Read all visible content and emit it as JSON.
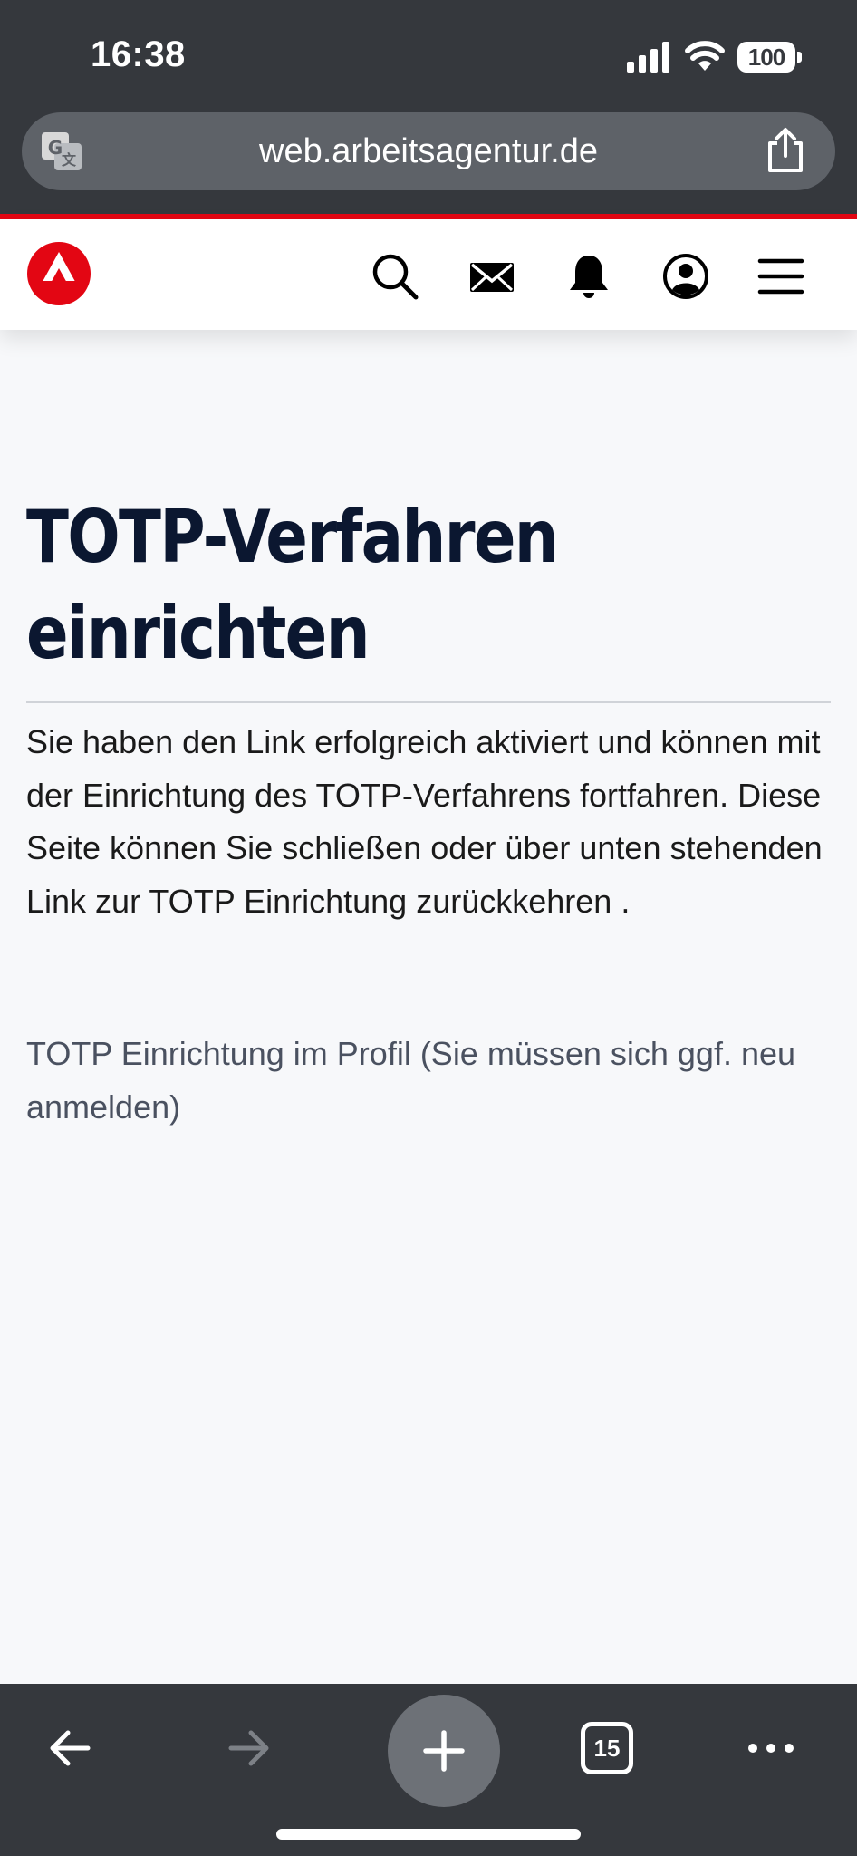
{
  "status_bar": {
    "time": "16:38",
    "battery": "100"
  },
  "browser": {
    "url": "web.arbeitsagentur.de",
    "tab_count": "15"
  },
  "header": {
    "icons": [
      "search-icon",
      "mail-icon",
      "bell-icon",
      "account-icon",
      "menu-icon"
    ]
  },
  "page": {
    "title": "TOTP-Verfahren einrichten",
    "intro": "Sie haben den Link erfolgreich aktiviert und können mit der Einrichtung des TOTP-Verfahrens fortfahren. Diese Seite können Sie schließen oder über unten stehenden Link zur TOTP Einrichtung zurückkehren .",
    "profile_link": "TOTP Einrichtung im Profil (Sie müssen sich ggf. neu anmelden)"
  },
  "colors": {
    "brand_red": "#e30613",
    "title": "#0b1730",
    "chrome": "#35383d"
  }
}
